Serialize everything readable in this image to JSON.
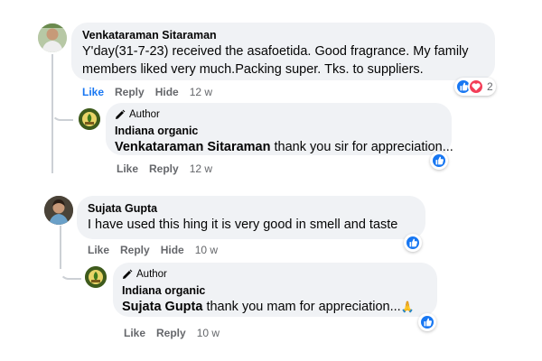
{
  "comments": [
    {
      "author": "Venkataraman Sitaraman",
      "text": "Y'day(31-7-23) received the asafoetida. Good fragrance. My family members liked very much.Packing super. Tks. to suppliers.",
      "actions": {
        "like": "Like",
        "reply": "Reply",
        "hide": "Hide",
        "time": "12 w"
      },
      "reactions": {
        "icons": [
          "like-icon",
          "love-icon"
        ],
        "count": "2"
      },
      "like_active": true,
      "reply": {
        "badge": "Author",
        "author": "Indiana organic",
        "mention": "Venkataraman Sitaraman",
        "text": " thank you sir for appreciation...",
        "actions": {
          "like": "Like",
          "reply": "Reply",
          "time": "12 w"
        },
        "reaction_icon": "like-icon"
      }
    },
    {
      "author": "Sujata Gupta",
      "text": "I have used this hing it is very good in smell and taste",
      "actions": {
        "like": "Like",
        "reply": "Reply",
        "hide": "Hide",
        "time": "10 w"
      },
      "reaction_icon": "like-icon",
      "reply": {
        "badge": "Author",
        "author": "Indiana organic",
        "mention": "Sujata Gupta",
        "text": " thank you mam for appreciation...",
        "emoji": "🙏",
        "actions": {
          "like": "Like",
          "reply": "Reply",
          "time": "10 w"
        },
        "reaction_icon": "like-icon"
      }
    }
  ],
  "colors": {
    "bubble": "#f0f2f5",
    "muted": "#65676b",
    "brand_blue": "#1877f2",
    "love_red": "#f33e58",
    "thread_line": "#ccd0d5"
  }
}
